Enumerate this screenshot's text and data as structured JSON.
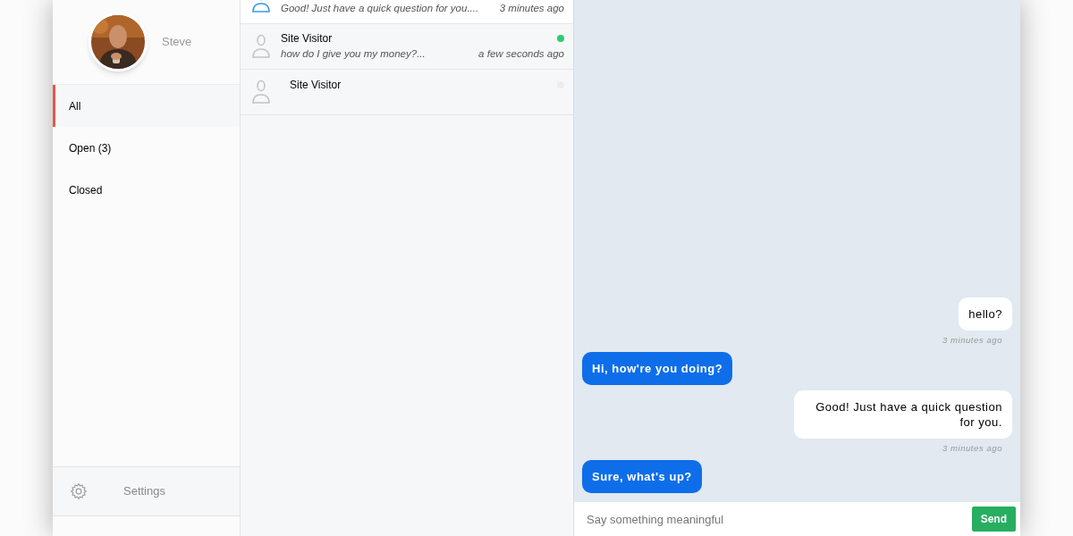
{
  "profile": {
    "name": "Steve"
  },
  "filters": [
    {
      "label": "All",
      "selected": true
    },
    {
      "label": "Open (3)",
      "selected": false
    },
    {
      "label": "Closed",
      "selected": false
    }
  ],
  "settings": {
    "label": "Settings"
  },
  "conversations": [
    {
      "preview": "Good! Just have a quick question for you....",
      "time": "3 minutes ago",
      "selected": true
    },
    {
      "name": "Site Visitor",
      "preview": "how do I give you my money?...",
      "time": "a few seconds ago",
      "selected": false,
      "online": true
    },
    {
      "name": "Site Visitor",
      "selected": false,
      "online": false
    }
  ],
  "messages": [
    {
      "kind": "visitor",
      "text": "hello?",
      "time": "3 minutes ago"
    },
    {
      "kind": "agent",
      "text": "Hi, how're you doing?"
    },
    {
      "kind": "visitor",
      "text": "Good! Just have a quick question for you.",
      "time": "3 minutes ago"
    },
    {
      "kind": "agent",
      "text": "Sure, what's up?"
    }
  ],
  "composer": {
    "placeholder": "Say something meaningful",
    "send": "Send"
  }
}
